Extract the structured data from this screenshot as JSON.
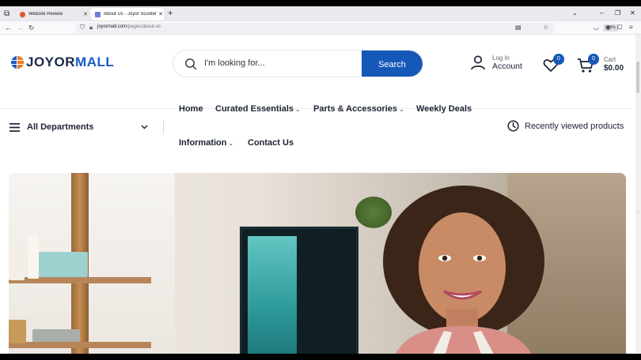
{
  "browser": {
    "tabs": [
      {
        "title": "Website Review",
        "active": false
      },
      {
        "title": "About Us - Joyor Scooters Offici",
        "active": true
      }
    ],
    "url_domain": "joyormall.com",
    "url_path": "/pages/about-us",
    "zoom": "180%"
  },
  "header": {
    "logo": {
      "part1": "JOYOR",
      "part2": "MALL"
    },
    "search": {
      "placeholder": "I'm looking for...",
      "button": "Search"
    },
    "account": {
      "small": "Log in",
      "big": "Account"
    },
    "wishlist_count": "0",
    "cart": {
      "count": "0",
      "small": "Cart",
      "big": "$0.00"
    }
  },
  "nav": {
    "departments": "All Departments",
    "menu": [
      {
        "label": "Home",
        "dropdown": false
      },
      {
        "label": "Curated Essentials",
        "dropdown": true
      },
      {
        "label": "Parts & Accessories",
        "dropdown": true
      },
      {
        "label": "Weekly Deals",
        "dropdown": false
      },
      {
        "label": "Information",
        "dropdown": true
      },
      {
        "label": "Contact Us",
        "dropdown": false
      }
    ],
    "recently_viewed": "Recently viewed products"
  },
  "colors": {
    "brand_blue": "#1558b8",
    "brand_dark": "#1b2a4a",
    "brand_orange": "#f37a1f"
  }
}
